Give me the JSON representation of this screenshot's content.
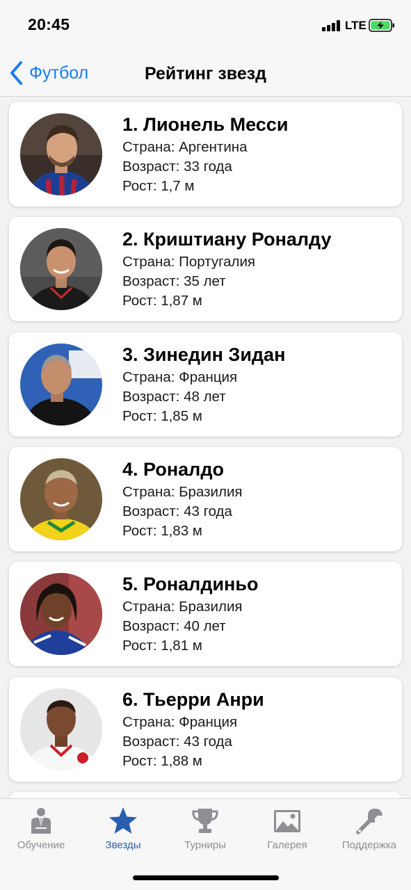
{
  "status_bar": {
    "time": "20:45",
    "network": "LTE"
  },
  "nav": {
    "back_label": "Футбол",
    "title": "Рейтинг звезд"
  },
  "players": [
    {
      "name": "1. Лионель Месси",
      "country": "Страна: Аргентина",
      "age": "Возраст: 33 года",
      "height": "Рост: 1,7 м"
    },
    {
      "name": "2. Криштиану Роналду",
      "country": "Страна: Португалия",
      "age": "Возраст: 35 лет",
      "height": "Рост: 1,87 м"
    },
    {
      "name": "3. Зинедин Зидан",
      "country": "Страна: Франция",
      "age": "Возраст: 48 лет",
      "height": "Рост: 1,85 м"
    },
    {
      "name": "4. Роналдо",
      "country": "Страна: Бразилия",
      "age": "Возраст: 43 года",
      "height": "Рост: 1,83 м"
    },
    {
      "name": "5. Роналдиньо",
      "country": "Страна: Бразилия",
      "age": "Возраст: 40 лет",
      "height": "Рост: 1,81 м"
    },
    {
      "name": "6. Тьерри Анри",
      "country": "Страна: Франция",
      "age": "Возраст: 43 года",
      "height": "Рост: 1,88 м"
    }
  ],
  "tabs": [
    {
      "label": "Обучение",
      "icon": "teacher-icon",
      "active": false
    },
    {
      "label": "Звезды",
      "icon": "star-icon",
      "active": true
    },
    {
      "label": "Турниры",
      "icon": "trophy-icon",
      "active": false
    },
    {
      "label": "Галерея",
      "icon": "photo-icon",
      "active": false
    },
    {
      "label": "Поддержка",
      "icon": "wrench-icon",
      "active": false
    }
  ],
  "colors": {
    "accent": "#1a7cf0",
    "active_tab": "#2a5fb0",
    "inactive_tab": "#8e8e93",
    "battery_charge": "#4cd964"
  }
}
